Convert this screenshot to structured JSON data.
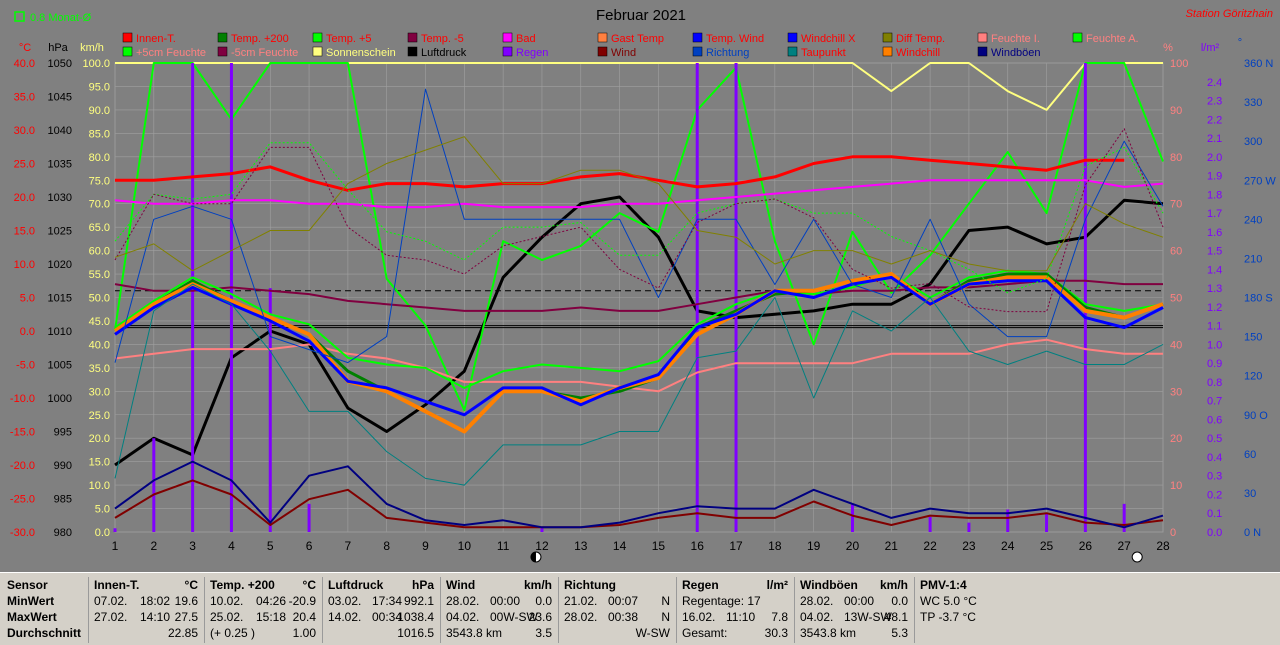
{
  "header": {
    "title": "Februar 2021",
    "station": "Station Göritzhain",
    "avg_label": "0.8 Monat-Ø"
  },
  "colors": {
    "background": "#808080",
    "station": "#ff0000",
    "grid": "#a0a0a0"
  },
  "axes": {
    "temp": {
      "unit": "°C",
      "ticks": [
        "40.0",
        "35.0",
        "30.0",
        "25.0",
        "20.0",
        "15.0",
        "10.0",
        "5.0",
        "0.0",
        "-5.0",
        "-10.0",
        "-15.0",
        "-20.0",
        "-25.0",
        "-30.0"
      ],
      "color": "#ff0000"
    },
    "pressure": {
      "unit": "hPa",
      "ticks": [
        "1050",
        "1045",
        "1040",
        "1035",
        "1030",
        "1025",
        "1020",
        "1015",
        "1010",
        "1005",
        "1000",
        "995",
        "990",
        "985",
        "980"
      ],
      "color": "#000000"
    },
    "wind": {
      "unit": "km/h",
      "ticks": [
        "100.0",
        "95.0",
        "90.0",
        "85.0",
        "80.0",
        "75.0",
        "70.0",
        "65.0",
        "60.0",
        "55.0",
        "50.0",
        "45.0",
        "40.0",
        "35.0",
        "30.0",
        "25.0",
        "20.0",
        "15.0",
        "10.0",
        "5.0",
        "0.0"
      ],
      "color": "#ffff80"
    },
    "humidity": {
      "unit": "%",
      "ticks": [
        "100",
        "90",
        "80",
        "70",
        "60",
        "50",
        "40",
        "30",
        "20",
        "10",
        "0"
      ],
      "color": "#ff8080"
    },
    "rain": {
      "unit": "l/m²",
      "ticks": [
        "2.4",
        "2.3",
        "2.2",
        "2.1",
        "2.0",
        "1.9",
        "1.8",
        "1.7",
        "1.6",
        "1.5",
        "1.4",
        "1.3",
        "1.2",
        "1.1",
        "1.0",
        "0.9",
        "0.8",
        "0.7",
        "0.6",
        "0.5",
        "0.4",
        "0.3",
        "0.2",
        "0.1",
        "0.0"
      ],
      "color": "#8000ff"
    },
    "direction": {
      "unit": "°",
      "ticks": [
        "360 N",
        "330",
        "300",
        "270 W",
        "240",
        "210",
        "180 S",
        "150",
        "120",
        "90 O",
        "60",
        "30",
        "0 N"
      ],
      "color": "#0040c0"
    },
    "days": [
      "1",
      "2",
      "3",
      "4",
      "5",
      "6",
      "7",
      "8",
      "9",
      "10",
      "11",
      "12",
      "13",
      "14",
      "15",
      "16",
      "17",
      "18",
      "19",
      "20",
      "21",
      "22",
      "23",
      "24",
      "25",
      "26",
      "27",
      "28"
    ]
  },
  "legend": [
    {
      "label": "Innen-T.",
      "color": "#ff0000",
      "text_color": "#ff0000"
    },
    {
      "label": "Temp. +200",
      "color": "#008000",
      "text_color": "#ff0000"
    },
    {
      "label": "Temp. +5",
      "color": "#00ff00",
      "text_color": "#ff0000"
    },
    {
      "label": "Temp. -5",
      "color": "#800040",
      "text_color": "#ff0000"
    },
    {
      "label": "Bad",
      "color": "#ff00ff",
      "text_color": "#ff0000"
    },
    {
      "label": "Gast Temp",
      "color": "#ff8040",
      "text_color": "#ff0000"
    },
    {
      "label": "Temp. Wind",
      "color": "#0000ff",
      "text_color": "#ff0000"
    },
    {
      "label": "Windchill X",
      "color": "#0000ff",
      "text_color": "#ff0000"
    },
    {
      "label": "Diff Temp.",
      "color": "#808000",
      "text_color": "#ff0000"
    },
    {
      "label": "Feuchte I.",
      "color": "#ff8080",
      "text_color": "#ff8080"
    },
    {
      "label": "Feuchte A.",
      "color": "#00ff00",
      "text_color": "#ff8080"
    },
    {
      "label": "+5cm Feuchte",
      "color": "#00ff00",
      "text_color": "#ff8080"
    },
    {
      "label": "-5cm Feuchte",
      "color": "#800040",
      "text_color": "#ff8080"
    },
    {
      "label": "Sonnenschein",
      "color": "#ffff80",
      "text_color": "#ffff80"
    },
    {
      "label": "Luftdruck",
      "color": "#000000",
      "text_color": "#000000"
    },
    {
      "label": "Regen",
      "color": "#8000ff",
      "text_color": "#8000ff"
    },
    {
      "label": "Wind",
      "color": "#800000",
      "text_color": "#800000"
    },
    {
      "label": "Richtung",
      "color": "#0040c0",
      "text_color": "#0040c0"
    },
    {
      "label": "Taupunkt",
      "color": "#008080",
      "text_color": "#ff0000"
    },
    {
      "label": "Windchill",
      "color": "#ff8000",
      "text_color": "#ff0000"
    },
    {
      "label": "Windböen",
      "color": "#000080",
      "text_color": "#000080"
    }
  ],
  "chart_data": {
    "type": "line",
    "x": [
      1,
      2,
      3,
      4,
      5,
      6,
      7,
      8,
      9,
      10,
      11,
      12,
      13,
      14,
      15,
      16,
      17,
      18,
      19,
      20,
      21,
      22,
      23,
      24,
      25,
      26,
      27,
      28
    ],
    "title": "Februar 2021",
    "series": [
      {
        "name": "Sonnenschein",
        "axis": "humidity",
        "color": "#ffff80",
        "width": 2,
        "values": [
          100,
          100,
          100,
          100,
          100,
          100,
          100,
          100,
          100,
          100,
          100,
          100,
          100,
          100,
          100,
          100,
          100,
          100,
          100,
          100,
          94,
          100,
          100,
          94,
          90,
          100,
          100,
          100
        ]
      },
      {
        "name": "Luftdruck",
        "axis": "pressure",
        "color": "#000000",
        "width": 3,
        "values": [
          990,
          994,
          991.5,
          1006,
          1010,
          1008,
          998.5,
          995,
          999,
          1004,
          1018,
          1024,
          1029,
          1030,
          1024,
          1013,
          1012,
          1012.5,
          1013,
          1014,
          1014,
          1017,
          1025,
          1025.5,
          1023,
          1024,
          1029.5,
          1029
        ]
      },
      {
        "name": "Feuchte A.",
        "axis": "humidity",
        "color": "#00ff00",
        "width": 2,
        "values": [
          43,
          100,
          100,
          88,
          100,
          100,
          100,
          54,
          44,
          26,
          62,
          58,
          61,
          68,
          64,
          90,
          99,
          62,
          40,
          64,
          51,
          59,
          70,
          81,
          68,
          100,
          100,
          79
        ]
      },
      {
        "name": "Regen",
        "axis": "rain",
        "color": "#8000ff",
        "width": 3,
        "type": "bar",
        "values": [
          0.02,
          0.5,
          2.5,
          2.5,
          1.3,
          0.15,
          0,
          0,
          0,
          0,
          0,
          0.02,
          0,
          0,
          0,
          2.5,
          2.5,
          0,
          0,
          0.15,
          0,
          0.08,
          0.05,
          0.12,
          0.1,
          2.5,
          0.15,
          0
        ]
      },
      {
        "name": "Innen-T.",
        "axis": "temp",
        "color": "#ff0000",
        "width": 3,
        "values": [
          22.5,
          22.5,
          23,
          23.5,
          24.5,
          22.5,
          21,
          22,
          22,
          21.5,
          22,
          22,
          23,
          23.5,
          22.5,
          21.5,
          22,
          23,
          25,
          26,
          26,
          25.5,
          25,
          24.5,
          24,
          25.5,
          25.5,
          null
        ]
      },
      {
        "name": "Bad",
        "axis": "temp",
        "color": "#ff00ff",
        "width": 2,
        "values": [
          19.5,
          19,
          19,
          19.5,
          19.5,
          19,
          19,
          18.5,
          18.5,
          19,
          18.5,
          18.5,
          18.5,
          19,
          19,
          19.5,
          20,
          20.5,
          21,
          21.5,
          22,
          22.5,
          22.5,
          22.5,
          22.5,
          22.5,
          21.5,
          22
        ]
      },
      {
        "name": "Feuchte I.",
        "axis": "humidity",
        "color": "#ff8080",
        "width": 2,
        "values": [
          37,
          38,
          39,
          39,
          39,
          40,
          38,
          37,
          35,
          32,
          32,
          32,
          32,
          31,
          30,
          34,
          36,
          36,
          36,
          36,
          38,
          38,
          38,
          40,
          41,
          39,
          38,
          38
        ]
      },
      {
        "name": "Temp. -5",
        "axis": "temp",
        "color": "#800040",
        "width": 2,
        "values": [
          7,
          6,
          6,
          6.5,
          6,
          5.5,
          4.5,
          4,
          3.5,
          3,
          3,
          3,
          3.5,
          3,
          3,
          4,
          5,
          6,
          5.5,
          6,
          6,
          6.5,
          6.5,
          7,
          7.5,
          7.5,
          7,
          7
        ]
      },
      {
        "name": "Temp. +5",
        "axis": "temp",
        "color": "#00ff00",
        "width": 2,
        "values": [
          0.5,
          4.5,
          8,
          5.5,
          2.5,
          1,
          -4,
          -5,
          -5.5,
          -8.5,
          -6,
          -5,
          -5.5,
          -6,
          -4.5,
          1,
          4,
          6,
          5.5,
          6.5,
          8.5,
          5,
          8,
          9,
          8.5,
          4,
          3,
          4
        ]
      },
      {
        "name": "Temp. +200",
        "axis": "temp",
        "color": "#008000",
        "width": 3,
        "values": [
          0,
          4,
          7.5,
          4.5,
          2,
          -0.5,
          -6,
          -9,
          -12,
          -15,
          -9,
          -9,
          -10,
          -9,
          -7,
          0.5,
          3,
          5.5,
          6,
          7.5,
          8.5,
          4,
          7.5,
          8.5,
          8.5,
          3.5,
          2,
          4
        ]
      },
      {
        "name": "Windchill",
        "axis": "temp",
        "color": "#ff8000",
        "width": 4,
        "values": [
          0,
          4,
          7,
          4.5,
          2,
          -0.5,
          -7.5,
          -9,
          -12,
          -15,
          -9,
          -9,
          -10.5,
          -8.5,
          -7,
          -0.5,
          2.5,
          6,
          6,
          7.5,
          8.5,
          4,
          7,
          8,
          8,
          3,
          2,
          4
        ]
      },
      {
        "name": "Temp. Wind",
        "axis": "temp",
        "color": "#0000ff",
        "width": 3,
        "values": [
          -0.5,
          3.5,
          6.5,
          4,
          1.5,
          -1.5,
          -7.5,
          -8.5,
          -10.5,
          -12.5,
          -8.5,
          -8.5,
          -11,
          -8.5,
          -6.5,
          0.5,
          2.5,
          6,
          5,
          7,
          8,
          4,
          7,
          7.5,
          7.5,
          2,
          0.5,
          3.5
        ]
      },
      {
        "name": "Wind",
        "axis": "wind",
        "color": "#800000",
        "width": 2,
        "values": [
          3,
          8,
          11,
          8,
          1.5,
          7,
          9,
          3,
          2,
          1,
          1,
          1,
          1,
          1.5,
          3,
          4,
          3,
          3,
          6.5,
          3.5,
          1.5,
          3.5,
          3,
          3,
          4,
          2,
          1.5,
          2.5
        ]
      },
      {
        "name": "Windböen",
        "axis": "wind",
        "color": "#000080",
        "width": 2,
        "values": [
          5,
          11,
          15,
          11,
          2,
          12,
          14,
          6,
          2.5,
          1.5,
          2.5,
          1,
          1,
          2,
          4,
          5.5,
          5,
          5,
          9,
          6,
          3,
          5,
          4,
          4,
          5,
          3,
          1,
          3.5
        ]
      },
      {
        "name": "Richtung",
        "axis": "direction",
        "color": "#0040c0",
        "width": 1,
        "values": [
          130,
          240,
          250,
          240,
          150,
          140,
          130,
          150,
          340,
          240,
          240,
          240,
          240,
          240,
          180,
          240,
          240,
          190,
          240,
          190,
          180,
          240,
          175,
          150,
          150,
          240,
          300,
          250
        ]
      },
      {
        "name": "Taupunkt",
        "axis": "temp",
        "color": "#008080",
        "width": 1,
        "values": [
          -22,
          3,
          7,
          4,
          -3,
          -12,
          -12,
          -18,
          -22,
          -23,
          -17,
          -17,
          -17,
          -15,
          -15,
          -4,
          -3,
          5,
          -10,
          3,
          0,
          5,
          -3,
          -5,
          -3,
          -5,
          -5,
          -2
        ]
      },
      {
        "name": "+5cm Feuchte",
        "axis": "humidity",
        "color": "#00ff00",
        "width": 1,
        "dash": "2,2",
        "values": [
          62,
          72,
          71,
          72,
          83,
          83,
          73,
          64,
          62,
          58,
          65,
          65,
          66,
          59,
          59,
          68,
          70,
          71,
          68,
          68,
          63,
          60,
          56,
          51,
          54,
          78,
          82,
          68
        ]
      },
      {
        "name": "-5cm Feuchte",
        "axis": "humidity",
        "color": "#800040",
        "width": 1,
        "dash": "2,2",
        "values": [
          58,
          72,
          70,
          70,
          82,
          82,
          65,
          59,
          58,
          55,
          61,
          63,
          65,
          56,
          52,
          66,
          70,
          71,
          67,
          56,
          52,
          53,
          48,
          47,
          47,
          74,
          86,
          65
        ]
      },
      {
        "name": "Diff Temp.",
        "axis": "temp",
        "color": "#808000",
        "width": 1,
        "values": [
          11,
          13,
          9,
          12,
          15,
          15,
          22,
          25,
          27,
          29,
          22,
          22,
          24,
          24,
          22,
          15,
          14,
          10,
          12,
          12,
          10,
          12,
          10,
          9,
          9,
          19,
          16,
          14
        ]
      }
    ],
    "reference_lines": [
      {
        "axis": "temp",
        "value": 6,
        "dash": "6,4",
        "color": "#000000"
      },
      {
        "axis": "temp",
        "value": 0.8,
        "dash": "",
        "color": "#000000"
      },
      {
        "axis": "pressure",
        "value": 1010.5,
        "dash": "",
        "color": "#000000"
      }
    ],
    "moon_markers": [
      {
        "x": 12,
        "phase": "new"
      },
      {
        "x": 27,
        "phase": "full"
      }
    ]
  },
  "stats": {
    "row_labels": {
      "sensor": "Sensor",
      "min": "MinWert",
      "max": "MaxWert",
      "avg": "Durchschnitt"
    },
    "innen": {
      "title": "Innen-T.",
      "unit": "°C",
      "min_date": "07.02.",
      "min_time": "18:02",
      "min_val": "19.6",
      "max_date": "27.02.",
      "max_time": "14:10",
      "max_val": "27.5",
      "avg": "22.85"
    },
    "temp200": {
      "title": "Temp. +200",
      "unit": "°C",
      "min_date": "10.02.",
      "min_time": "04:26",
      "min_val": "-20.9",
      "max_date": "25.02.",
      "max_time": "15:18",
      "max_val": "20.4",
      "avg_note": "(+ 0.25 )",
      "avg": "1.00"
    },
    "druck": {
      "title": "Luftdruck",
      "unit": "hPa",
      "min_date": "03.02.",
      "min_time": "17:34",
      "min_val": "992.1",
      "max_date": "14.02.",
      "max_time": "00:34",
      "max_val": "1038.4",
      "avg": "1016.5"
    },
    "wind": {
      "title": "Wind",
      "unit": "km/h",
      "min_date": "28.02.",
      "min_time": "00:00",
      "min_val": "0.0",
      "max_date": "04.02.",
      "max_time": "00W-SW",
      "max_val": "23.6",
      "avg_km": "3543.8 km",
      "avg": "3.5"
    },
    "richtung": {
      "title": "Richtung",
      "min_date": "21.02.",
      "min_time": "00:07",
      "min_val": "N",
      "max_date": "28.02.",
      "max_time": "00:38",
      "max_val": "N",
      "avg": "W-SW"
    },
    "regen": {
      "title": "Regen",
      "unit": "l/m²",
      "days_label": "Regentage: 17",
      "max_date": "16.02.",
      "max_time": "11:10",
      "max_val": "7.8",
      "total_label": "Gesamt:",
      "total": "30.3"
    },
    "boeen": {
      "title": "Windböen",
      "unit": "km/h",
      "min_date": "28.02.",
      "min_time": "00:00",
      "min_val": "0.0",
      "max_date": "04.02.",
      "max_time": "13W-SW",
      "max_val": "48.1",
      "avg_km": "3543.8 km",
      "avg": "5.3"
    },
    "pmv": {
      "title": "PMV-1:4",
      "wc": "WC 5.0 °C",
      "tp": "TP -3.7 °C"
    }
  }
}
